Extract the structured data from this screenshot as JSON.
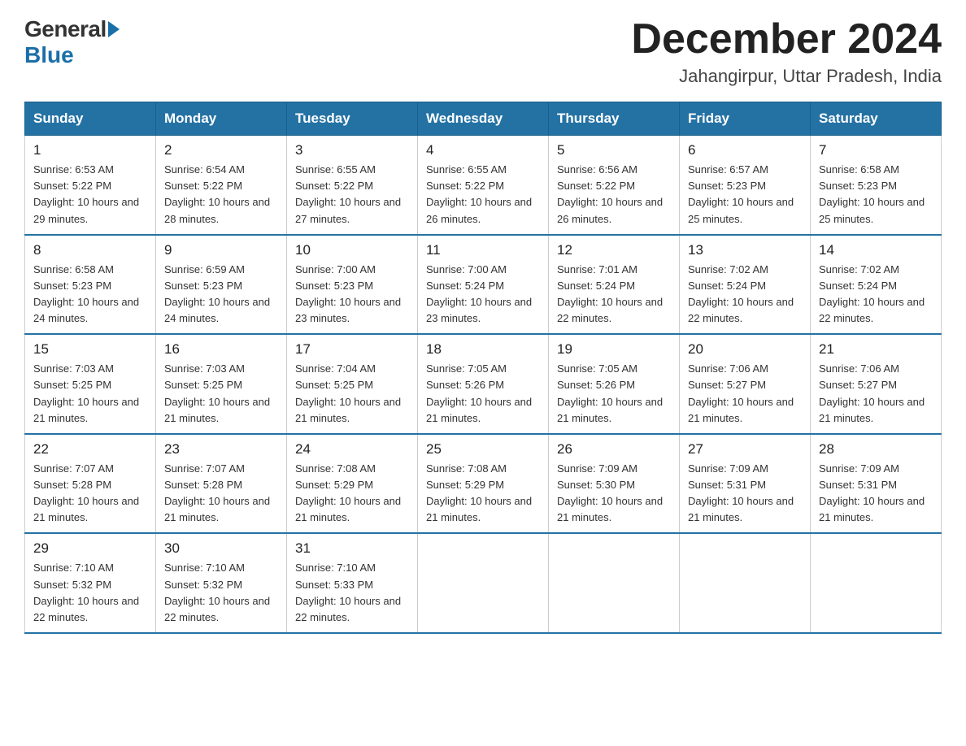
{
  "logo": {
    "general": "General",
    "blue": "Blue"
  },
  "title": "December 2024",
  "location": "Jahangirpur, Uttar Pradesh, India",
  "header_days": [
    "Sunday",
    "Monday",
    "Tuesday",
    "Wednesday",
    "Thursday",
    "Friday",
    "Saturday"
  ],
  "weeks": [
    [
      {
        "day": "1",
        "sunrise": "6:53 AM",
        "sunset": "5:22 PM",
        "daylight": "10 hours and 29 minutes."
      },
      {
        "day": "2",
        "sunrise": "6:54 AM",
        "sunset": "5:22 PM",
        "daylight": "10 hours and 28 minutes."
      },
      {
        "day": "3",
        "sunrise": "6:55 AM",
        "sunset": "5:22 PM",
        "daylight": "10 hours and 27 minutes."
      },
      {
        "day": "4",
        "sunrise": "6:55 AM",
        "sunset": "5:22 PM",
        "daylight": "10 hours and 26 minutes."
      },
      {
        "day": "5",
        "sunrise": "6:56 AM",
        "sunset": "5:22 PM",
        "daylight": "10 hours and 26 minutes."
      },
      {
        "day": "6",
        "sunrise": "6:57 AM",
        "sunset": "5:23 PM",
        "daylight": "10 hours and 25 minutes."
      },
      {
        "day": "7",
        "sunrise": "6:58 AM",
        "sunset": "5:23 PM",
        "daylight": "10 hours and 25 minutes."
      }
    ],
    [
      {
        "day": "8",
        "sunrise": "6:58 AM",
        "sunset": "5:23 PM",
        "daylight": "10 hours and 24 minutes."
      },
      {
        "day": "9",
        "sunrise": "6:59 AM",
        "sunset": "5:23 PM",
        "daylight": "10 hours and 24 minutes."
      },
      {
        "day": "10",
        "sunrise": "7:00 AM",
        "sunset": "5:23 PM",
        "daylight": "10 hours and 23 minutes."
      },
      {
        "day": "11",
        "sunrise": "7:00 AM",
        "sunset": "5:24 PM",
        "daylight": "10 hours and 23 minutes."
      },
      {
        "day": "12",
        "sunrise": "7:01 AM",
        "sunset": "5:24 PM",
        "daylight": "10 hours and 22 minutes."
      },
      {
        "day": "13",
        "sunrise": "7:02 AM",
        "sunset": "5:24 PM",
        "daylight": "10 hours and 22 minutes."
      },
      {
        "day": "14",
        "sunrise": "7:02 AM",
        "sunset": "5:24 PM",
        "daylight": "10 hours and 22 minutes."
      }
    ],
    [
      {
        "day": "15",
        "sunrise": "7:03 AM",
        "sunset": "5:25 PM",
        "daylight": "10 hours and 21 minutes."
      },
      {
        "day": "16",
        "sunrise": "7:03 AM",
        "sunset": "5:25 PM",
        "daylight": "10 hours and 21 minutes."
      },
      {
        "day": "17",
        "sunrise": "7:04 AM",
        "sunset": "5:25 PM",
        "daylight": "10 hours and 21 minutes."
      },
      {
        "day": "18",
        "sunrise": "7:05 AM",
        "sunset": "5:26 PM",
        "daylight": "10 hours and 21 minutes."
      },
      {
        "day": "19",
        "sunrise": "7:05 AM",
        "sunset": "5:26 PM",
        "daylight": "10 hours and 21 minutes."
      },
      {
        "day": "20",
        "sunrise": "7:06 AM",
        "sunset": "5:27 PM",
        "daylight": "10 hours and 21 minutes."
      },
      {
        "day": "21",
        "sunrise": "7:06 AM",
        "sunset": "5:27 PM",
        "daylight": "10 hours and 21 minutes."
      }
    ],
    [
      {
        "day": "22",
        "sunrise": "7:07 AM",
        "sunset": "5:28 PM",
        "daylight": "10 hours and 21 minutes."
      },
      {
        "day": "23",
        "sunrise": "7:07 AM",
        "sunset": "5:28 PM",
        "daylight": "10 hours and 21 minutes."
      },
      {
        "day": "24",
        "sunrise": "7:08 AM",
        "sunset": "5:29 PM",
        "daylight": "10 hours and 21 minutes."
      },
      {
        "day": "25",
        "sunrise": "7:08 AM",
        "sunset": "5:29 PM",
        "daylight": "10 hours and 21 minutes."
      },
      {
        "day": "26",
        "sunrise": "7:09 AM",
        "sunset": "5:30 PM",
        "daylight": "10 hours and 21 minutes."
      },
      {
        "day": "27",
        "sunrise": "7:09 AM",
        "sunset": "5:31 PM",
        "daylight": "10 hours and 21 minutes."
      },
      {
        "day": "28",
        "sunrise": "7:09 AM",
        "sunset": "5:31 PM",
        "daylight": "10 hours and 21 minutes."
      }
    ],
    [
      {
        "day": "29",
        "sunrise": "7:10 AM",
        "sunset": "5:32 PM",
        "daylight": "10 hours and 22 minutes."
      },
      {
        "day": "30",
        "sunrise": "7:10 AM",
        "sunset": "5:32 PM",
        "daylight": "10 hours and 22 minutes."
      },
      {
        "day": "31",
        "sunrise": "7:10 AM",
        "sunset": "5:33 PM",
        "daylight": "10 hours and 22 minutes."
      },
      null,
      null,
      null,
      null
    ]
  ],
  "colors": {
    "header_bg": "#2472a4",
    "header_text": "#ffffff",
    "border": "#2472a4"
  }
}
